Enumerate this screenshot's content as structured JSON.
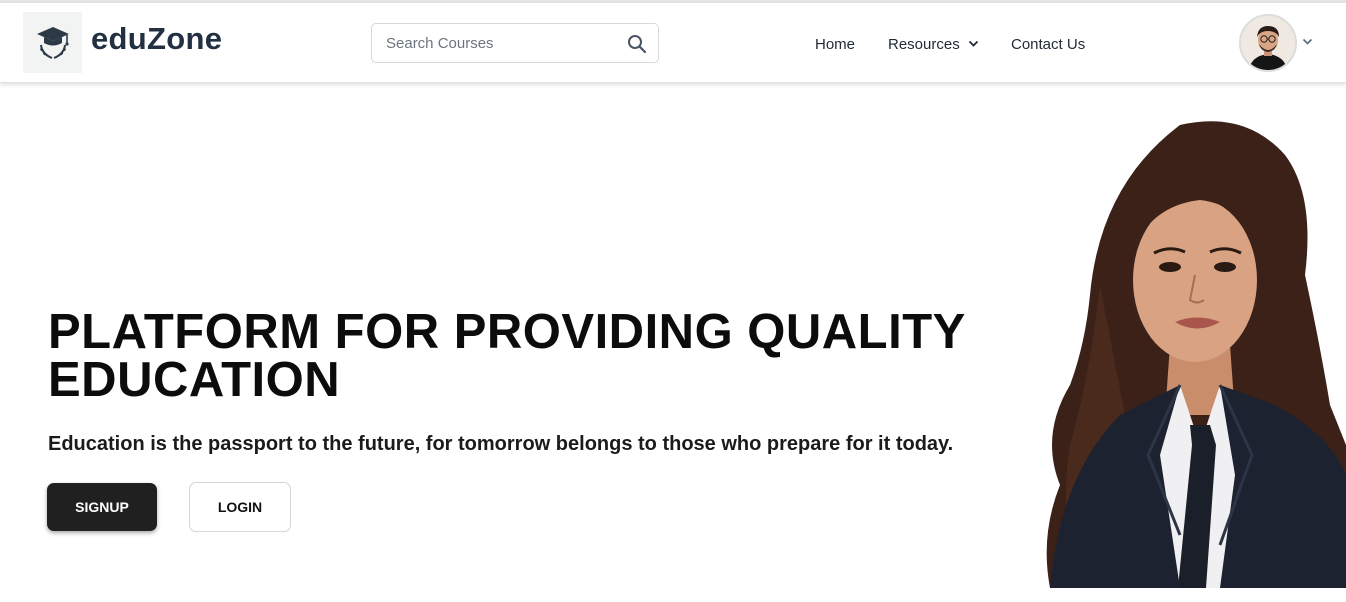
{
  "header": {
    "brand": "eduZone",
    "logo_icon": "graduation-cap-laurel-icon",
    "search": {
      "placeholder": "Search Courses",
      "value": "",
      "icon": "search-icon"
    },
    "nav": {
      "home": "Home",
      "resources": "Resources",
      "contact": "Contact Us"
    },
    "profile": {
      "avatar_icon": "user-avatar",
      "menu_icon": "chevron-down-icon"
    }
  },
  "hero": {
    "title": "PLATFORM FOR PROVIDING QUALITY EDUCATION",
    "subtitle": "Education is the passport to the future, for tomorrow belongs to those who prepare for it today.",
    "signup_label": "SIGNUP",
    "login_label": "LOGIN",
    "image": "woman-in-business-suit-portrait"
  },
  "colors": {
    "brand_text": "#233041",
    "signup_bg": "#202020",
    "title_text": "#0c0c0c"
  }
}
